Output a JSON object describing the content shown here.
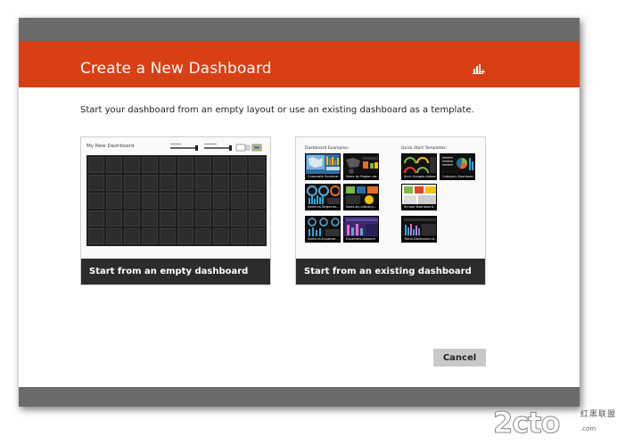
{
  "dialog": {
    "title": "Create a New Dashboard",
    "header_icon": "bar-chart-add-icon",
    "instruction": "Start your dashboard from an empty layout or use an existing dashboard as a template.",
    "cancel_label": "Cancel"
  },
  "options": [
    {
      "caption": "Start from an empty dashboard",
      "preview_title": "My New Dashboard"
    },
    {
      "caption": "Start from an existing dashboard",
      "examples_label": "Dashboard Examples:",
      "templates_label": "Quick Start Templates:",
      "examples": [
        "Corporate Scorecar...",
        "Sales by Region.da...",
        "Sales-vs-Target.da...",
        "Sales-by-Industry...",
        "Sales-vs-Expense...",
        "Expenses.dabeom"
      ],
      "templates": [
        "Arch-Gauges.dabeom",
        "Category-Dashboar...",
        "Simple-Dashboard...",
        "Trend-Dashboard.d..."
      ]
    }
  ],
  "colors": {
    "accent": "#d93f14",
    "bars": "#6b6b6b",
    "caption_bg": "#2c2c2c"
  },
  "watermark": {
    "logo": "2cto",
    "cn": "红黑联盟",
    "url": ".com"
  }
}
